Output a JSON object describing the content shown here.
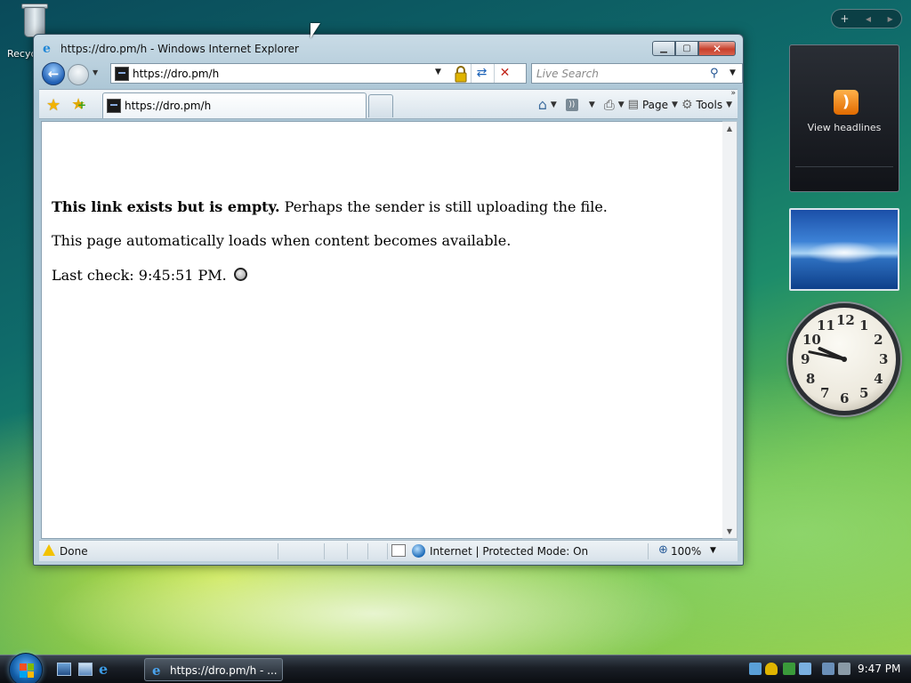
{
  "desktop": {
    "recycle_bin_label": "Recyc"
  },
  "window": {
    "title": "https://dro.pm/h - Windows Internet Explorer",
    "address_url": "https://dro.pm/h",
    "search_placeholder": "Live Search",
    "tab_label": "https://dro.pm/h",
    "commands": {
      "page_label": "Page",
      "tools_label": "Tools"
    },
    "content": {
      "bold_text": "This link exists but is empty.",
      "line1_rest": " Perhaps the sender is still uploading the file.",
      "line2": "This page automatically loads when content becomes available.",
      "line3": "Last check: 9:45:51 PM."
    },
    "status": {
      "text": "Done",
      "zone": "Internet | Protected Mode: On",
      "zoom": "100%"
    }
  },
  "gadgets": {
    "feed_label": "View headlines",
    "clock_numbers": [
      "12",
      "1",
      "2",
      "3",
      "4",
      "5",
      "6",
      "7",
      "8",
      "9",
      "10",
      "11"
    ],
    "clock_time": {
      "hour": 9,
      "minute": 47
    }
  },
  "taskbar": {
    "task_label": "https://dro.pm/h - ...",
    "clock": "9:47 PM"
  },
  "icons": {
    "back": "back-arrow-icon",
    "forward": "forward-arrow-icon",
    "refresh": "refresh-icon",
    "stop": "stop-icon",
    "search": "search-icon",
    "favorites": "favorites-star-icon",
    "home": "home-icon",
    "feeds": "feeds-icon",
    "print": "print-icon",
    "tools": "gear-icon"
  },
  "colors": {
    "close_button": "#c7402c",
    "ie_blue": "#1f86d6",
    "rss_orange": "#e06a00"
  }
}
